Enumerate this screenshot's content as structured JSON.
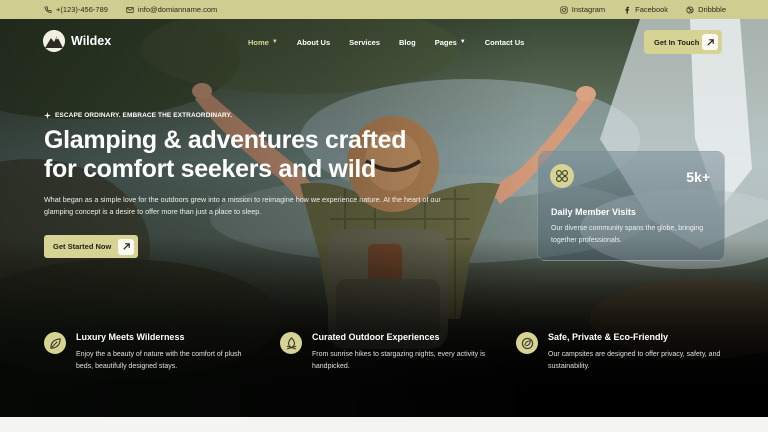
{
  "topbar": {
    "phone": "+(123)-456-789",
    "email": "info@domianname.com",
    "socials": [
      {
        "label": "Instagram",
        "icon": "instagram-icon"
      },
      {
        "label": "Facebook",
        "icon": "facebook-icon"
      },
      {
        "label": "Dribbble",
        "icon": "dribbble-icon"
      }
    ]
  },
  "brand": {
    "name": "Wildex",
    "accent": "#d7d394"
  },
  "nav": {
    "items": [
      {
        "label": "Home",
        "dropdown": true,
        "active": true
      },
      {
        "label": "About Us"
      },
      {
        "label": "Services"
      },
      {
        "label": "Blog"
      },
      {
        "label": "Pages",
        "dropdown": true
      },
      {
        "label": "Contact Us"
      }
    ],
    "cta": "Get In Touch"
  },
  "hero": {
    "eyebrow": "ESCAPE ORDINARY. EMBRACE THE EXTRAORDINARY.",
    "headline": "Glamping & adventures crafted for comfort seekers and wild",
    "lede": "What began as a simple love for the outdoors grew into a mission to reimagine how we experience nature. At the heart of our glamping concept is a desire to offer more than just a place to sleep.",
    "button": "Get Started Now"
  },
  "stat_card": {
    "value": "5k+",
    "title": "Daily Member Visits",
    "description": "Our diverse community spans the globe, bringing together professionals."
  },
  "features": [
    {
      "title": "Luxury Meets Wilderness",
      "description": "Enjoy the a beauty of nature with the comfort of plush beds, beautifully designed stays.",
      "icon": "leaf-icon"
    },
    {
      "title": "Curated Outdoor Experiences",
      "description": "From sunrise hikes to stargazing nights, every activity is handpicked.",
      "icon": "campfire-icon"
    },
    {
      "title": "Safe, Private & Eco-Friendly",
      "description": "Our campsites are designed to offer privacy, safety, and sustainability.",
      "icon": "eco-icon"
    }
  ]
}
